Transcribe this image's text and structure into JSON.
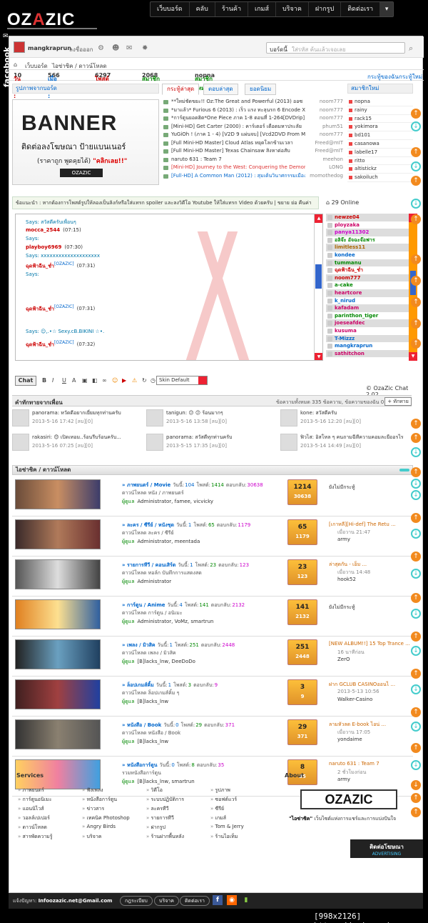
{
  "nav": {
    "logo_left": "OZ",
    "logo_mid": "A",
    "logo_right": "ZIC",
    "items": [
      "เว็บบอร์ด",
      "คลับ",
      "ร้านค้า",
      "เกมส์",
      "บริจาค",
      "ฝากรูป",
      "ติดต่อเรา"
    ]
  },
  "facebook_tab": "facebook",
  "userbar": {
    "username": "mangkraprun",
    "logout": "ลงชื่อออก",
    "search_label": "บอร์ดนี้",
    "search_placeholder": "ใส่รหัส ค้นแล้วเจอเลย"
  },
  "breadcrumb": [
    "เว็บบอร์ด",
    "ไอซ่าซิค / ดาวน์โหลด"
  ],
  "stats": {
    "today_label": "วันนี้ :",
    "today": "10",
    "yesterday_label": "เมื่อวาน :",
    "yesterday": "566",
    "posts_label": "โพสต์ :",
    "posts": "6297",
    "members_label": "สมาชิก :",
    "members": "2068",
    "newest_label": "สมาชิกใหม่ :",
    "newest": "nopna",
    "link1": "กระทู้ของฉัน",
    "link2": "กระทู้ใหม่"
  },
  "banner": {
    "head": "รูปภาพจากบอร์ด",
    "big": "BANNER",
    "line1": "ติดต่อลงโฆษณา ป้ายแบนเนอร์",
    "line2": "(ราคาถูก พูดคุยได้)",
    "line2_link": "\"คลิกเลย!!\"",
    "footer": "OZAZIC"
  },
  "tabs": [
    "กระทู้ล่าสุด",
    "ตอบล่าสุด",
    "ยอดนิยม"
  ],
  "new_posts": [
    {
      "title": "**ใหม่ชัดขยะ!! Oz:The Great and Powerful (2013) ออซ",
      "user": "noom777",
      "color": "#333"
    },
    {
      "title": "*มาแล้ว* Furious 6 (2013) : เร็ว แรง ทะลุนรก 6 Encode Xvid",
      "user": "noom777",
      "color": "#333"
    },
    {
      "title": "*การ์ตูนยอดฮิต*One Piece ภาค 1-8 ตอนที่ 1-264[DVDrip]",
      "user": "noom777",
      "color": "#333"
    },
    {
      "title": "[Mini-HD] Get Carter (2000) : คาร์เตอร์ เดือดมหาประลัย",
      "user": "phum51",
      "color": "#333"
    },
    {
      "title": "YuGiOh ! (ภาค 1 - 4) [V2D 9 แผ่นจบ] [Vcd2DVD From Master]",
      "user": "noom777",
      "color": "#333"
    },
    {
      "title": "[Full Mini-HD Master] Cloud Atlas หยุดโลกข้ามเวลา",
      "user": "Freed@mIT",
      "color": "#333"
    },
    {
      "title": "[Full Mini-HD Master] Texas Chainsaw สิงหาต่อสับ",
      "user": "Freed@mIT",
      "color": "#333"
    },
    {
      "title": "naruto 631 : Team 7",
      "user": "meehon",
      "color": "#333"
    },
    {
      "title": "[Mini-HD] Journey to the West: Conquering the Demons ไซอิ๋ว",
      "user": "LONG",
      "color": "#d33"
    },
    {
      "title": "[Full-HD] A Common Man (2012) : สุมเต้นวินาศกรรมเมือง",
      "user": "momothedog",
      "color": "#06c"
    }
  ],
  "members_head": "สมาชิกใหม่",
  "new_members": [
    "nopna",
    "rainy",
    "rack15",
    "yokimora",
    "bd101",
    "casanowa",
    "labelle17",
    "ritto",
    "altistickz",
    "sakoiluch"
  ],
  "chat": {
    "note": "ข้อแนะนำ : หากต้องการโพสต์รูปให้ลองเป็นลิงก์หรือใส่แทรก spoiler และลงวิดีโอ Youtube ให้ใส่แทรก Video ด้วยครับ | ขยาย ย่อ คืนค่า",
    "online": "29 Online",
    "lines": [
      {
        "user": "",
        "text": "Says: สวัสดีครับเพื่อนๆ",
        "time": ""
      },
      {
        "user": "mocca_2544",
        "text": "",
        "time": "(07:15)"
      },
      {
        "user": "",
        "text": "Says:",
        "time": ""
      },
      {
        "user": "playboy6969",
        "text": "",
        "time": "(07:30)"
      },
      {
        "user": "",
        "text": "Says: xxxxxxxxxxxxxxxxxxxx",
        "time": ""
      },
      {
        "user": "ฉุดฟ้าฉีน_ช่ำ",
        "text": "[OZAZIC]",
        "time": "(07:31)"
      },
      {
        "user": "",
        "text": "Says:",
        "time": ""
      },
      {
        "user": "ฉุดฟ้าฉีน_ช่ำ",
        "text": "[OZAZIC]",
        "time": "(07:31)"
      },
      {
        "user": "",
        "text": "Says: ☺,.•☆ Sexy.cB.BIKINI ☆•.",
        "time": ""
      },
      {
        "user": "ฉุดฟ้าฉีน_ช่ำ",
        "text": "[OZAZIC]",
        "time": "(07:32)"
      }
    ],
    "users": [
      "newze04",
      "ployzaka",
      "panya11302",
      "อลิจ๊ะ อัจฉะจ๊อฟาร",
      "limitless11",
      "kondee",
      "tummanu",
      "ฉุดฟ้าฉีน_ช่ำ",
      "noom777",
      "a-cake",
      "heartcore",
      "k_nirud",
      "kafadam",
      "parinthon_tiger",
      "joeseafdec",
      "kusuma",
      "T-Mizzz",
      "mangkraprun",
      "sathitchon"
    ],
    "send": "Chat",
    "skin": "Skin Default",
    "version": "© OzaZic Chat 2.02"
  },
  "friends": {
    "head": "คำทักทายจากเพื่อน",
    "summary": "ข้อความทั้งหมด 335 ข้อความ, ข้อความของฉัน 0 ข้อความ",
    "add": "ทักทาย",
    "items": [
      {
        "text": "panorama: หวัดดีอยากเยี่ยมทุกท่านครับ",
        "time": "2013-5-16 17:42 [ลบ][0]"
      },
      {
        "text": "tanigun: 😕 😕 ร้อนมากๆ",
        "time": "2013-5-16 13:58 [ลบ][0]"
      },
      {
        "text": "kone: สวัสดีครับ",
        "time": "2013-5-16 12:20 [ลบ][0]"
      },
      {
        "text": "rakasiri: 😊 เปิดเทอม..ร้อนรีบร้อนครับ...",
        "time": "2013-5-16 07:25 [ลบ][0]"
      },
      {
        "text": "panorama: สวัสดีทุกท่านครับ",
        "time": "2013-5-15 17:35 [ลบ][0]"
      },
      {
        "text": "ฟิวไส: อิสโหล ๆ คนถามฉีทีความคอมละยืออรไร",
        "time": "2013-5-14 14:49 [ลบ][0]"
      }
    ]
  },
  "forum": {
    "head": "ไอซ่าซิค / ดาวน์โหลด",
    "rows": [
      {
        "name": "ภาพยนตร์ / Movie",
        "today": "104",
        "posts": "1414",
        "replies": "30638",
        "desc": "ดาวน์โหลด หนัง / ภาพยนตร์",
        "mods": "Administrator, famee, vicvicky",
        "c1": "1214",
        "c2": "30638",
        "last_title": "",
        "last_time": "",
        "last_user": "",
        "none": "ยังไม่มีกระทู้"
      },
      {
        "name": "ละคร / ซีรีย์ / หนังชุด",
        "today": "1",
        "posts": "65",
        "replies": "1179",
        "desc": "ดาวน์โหลด ละคร / ซีรีย์",
        "mods": "Administrator, meentada",
        "c1": "65",
        "c2": "1179",
        "last_title": "[เกาหลี][Hi-def] The Retu ...",
        "last_time": "เมื่อวาน 21:47",
        "last_user": "army",
        "none": ""
      },
      {
        "name": "รายการทีวี / คอนเสิร์ต",
        "today": "1",
        "posts": "23",
        "replies": "123",
        "desc": "ดาวน์โหลด ทอล์ก บันทึกการแสดงสด",
        "mods": "Administrator",
        "c1": "23",
        "c2": "123",
        "last_title": "ล่าสุดกัน - เอ็ม ...",
        "last_time": "เมื่อวาน 14:48",
        "last_user": "hook52",
        "none": ""
      },
      {
        "name": "การ์ตูน / Anime",
        "today": "4",
        "posts": "141",
        "replies": "2132",
        "desc": "ดาวน์โหลด การ์ตูน / อนิเมะ",
        "mods": "Administrator, VoMz, smartrun",
        "c1": "141",
        "c2": "2132",
        "last_title": "",
        "last_time": "",
        "last_user": "",
        "none": "ยังไม่มีกระทู้"
      },
      {
        "name": "เพลง / มิวสิค",
        "today": "1",
        "posts": "251",
        "replies": "2448",
        "desc": "ดาวน์โหลด เพลง / มิวสิค",
        "mods": "[B]lacks_lnw, DeeDoDo",
        "c1": "251",
        "c2": "2448",
        "last_title": "[NEW ALBUM!!] 15 Top Trance ...",
        "last_time": "16 นาทีก่อน",
        "last_user": "ZerO",
        "none": ""
      },
      {
        "name": "ล็อปเกมส์คิ้ม",
        "today": "1",
        "posts": "3",
        "replies": "9",
        "desc": "ดาวน์โหลด ล็อปเกมส์คิ้ม ๆ",
        "mods": "[B]lacks_lnw",
        "c1": "3",
        "c2": "9",
        "last_title": "ฝาก GCLUB CASINOออนไ ...",
        "last_time": "2013-5-13 10:56",
        "last_user": "Walker-Casino",
        "none": ""
      },
      {
        "name": "หนังสือ / Book",
        "today": "0",
        "posts": "29",
        "replies": "371",
        "desc": "ดาวน์โหลด หนังสือ / Book",
        "mods": "[B]lacks_lnw",
        "c1": "29",
        "c2": "371",
        "last_title": "ลามหัวลด E-book ไอน่ ...",
        "last_time": "เมื่อวาน 17:05",
        "last_user": "yondaime",
        "none": ""
      },
      {
        "name": "หนังสือการ์ตูน",
        "today": "0",
        "posts": "8",
        "replies": "35",
        "desc": "รวมหนังสือการ์ตูน",
        "mods": "[B]lacks_lnw, smartrun",
        "c1": "8",
        "c2": "35",
        "last_title": "naruto 631 : Team 7",
        "last_time": "2 ชั่วโมงก่อน",
        "last_user": "army",
        "none": ""
      }
    ],
    "today_label": "วันนี้:",
    "posts_label": "โพสต์:",
    "replies_label": "ตอบกลับ:",
    "mod_label": "ผู้ดูแล"
  },
  "footer": {
    "services_head": "Services",
    "about_head": "About",
    "services": [
      "ภาพยนตร์",
      "การ์ตูนอนิเมะ",
      "แอนนิไวส์",
      "วอลล์เปเปอร์",
      "ดาวน์โหลด",
      "สารพัดความรู้",
      "ฟังเพลง",
      "หนังสือการ์ตูน",
      "ข่าวสาร",
      "เทคนิค Photoshop",
      "Angry Birds",
      "บริจาค",
      "วิดีโอ",
      "ระบบปฏิบัติการ",
      "ละครทีวี",
      "รายการทีวี",
      "ฝากรูป",
      "ร้านฝากพื้นหลัง",
      "รูปภาพ",
      "ซอฟต์แวร์",
      "ซีรีย์",
      "เกมส์",
      "Tom & Jerry",
      "ร้านไอเท็ม"
    ],
    "about_logo": "OZAZIC",
    "about_desc_bold": "\"ไอซ่าซิค\"",
    "about_desc": "เว็บไซต์แห่งการแชร์และการแบ่งปันใจ",
    "ad_title": "ติดต่อโฆษณา",
    "ad_sub": "ADVERTISING",
    "contact_label": "แจ้งปัญหา:",
    "contact_email": "Infoozazic.net@Gmail.com",
    "buttons": [
      "กฎระเบียบ",
      "บริจาค",
      "ติดต่อเรา"
    ]
  },
  "watermark": "[998x2126] https://upic.me/"
}
